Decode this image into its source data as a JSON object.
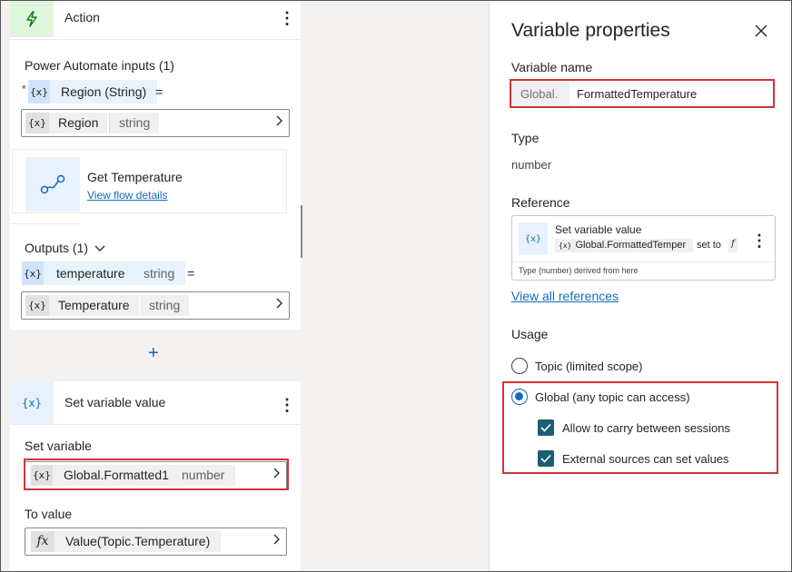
{
  "action_card": {
    "title": "Action",
    "inputs_heading": "Power Automate inputs (1)",
    "input_param_chip": "{x}",
    "input_param_label": "Region (String)",
    "equals": "=",
    "input_value_chip": "{x}",
    "input_value_name": "Region",
    "input_value_type": "string",
    "flow_name": "Get Temperature",
    "flow_link": "View flow details",
    "outputs_heading": "Outputs (1)",
    "output_param_chip": "{x}",
    "output_param_name": "temperature",
    "output_param_type": "string",
    "output_value_chip": "{x}",
    "output_value_name": "Temperature",
    "output_value_type": "string"
  },
  "add_node": "+",
  "set_var_card": {
    "icon_text": "{x}",
    "title": "Set variable value",
    "set_variable_label": "Set variable",
    "var_chip": "{x}",
    "var_name": "Global.Formatted1",
    "var_type": "number",
    "to_value_label": "To value",
    "fx": "fx",
    "to_value": "Value(Topic.Temperature)"
  },
  "panel": {
    "title": "Variable properties",
    "var_name_label": "Variable name",
    "var_prefix": "Global.",
    "var_name_value": "FormattedTemperature",
    "type_label": "Type",
    "type_value": "number",
    "reference_label": "Reference",
    "ref_icon": "{x}",
    "ref_title": "Set variable value",
    "ref_chip": "{x}",
    "ref_var": "Global.FormattedTemper",
    "ref_set_to": "set to",
    "ref_fx": "f",
    "ref_note": "Type (number) derived from here",
    "view_all_link": "View all references",
    "usage_label": "Usage",
    "usage_options": [
      "Topic (limited scope)",
      "Global (any topic can access)"
    ],
    "usage_selected": "Global (any topic can access)",
    "checkbox_carry": "Allow to carry between sessions",
    "checkbox_external": "External sources can set values"
  },
  "colors": {
    "accent": "#0f6cbd",
    "highlight": "#d13438",
    "checkbox": "#1b5e73",
    "chip_blue": "#cfe4fa"
  }
}
